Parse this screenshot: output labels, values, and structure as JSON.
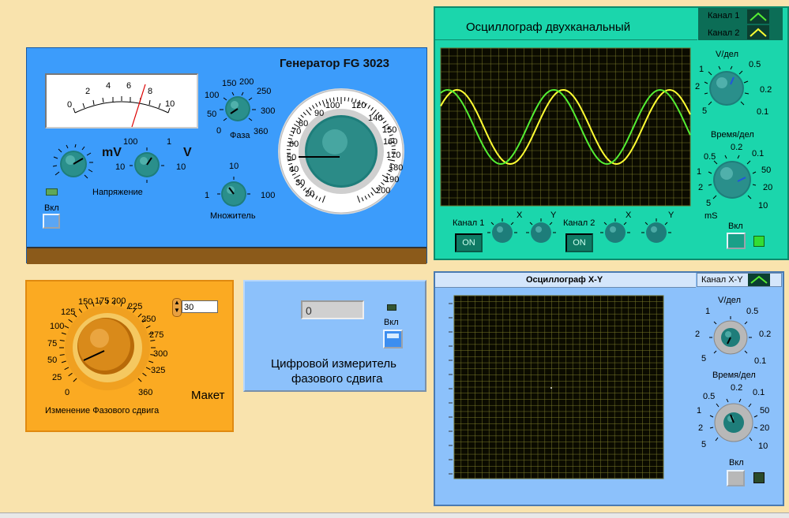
{
  "generator": {
    "title": "Генератор FG 3023",
    "meter_ticks": [
      "0",
      "2",
      "4",
      "6",
      "8",
      "10"
    ],
    "mv_label": "mV",
    "v_label": "V",
    "range_ticks": {
      "top": "100",
      "right": "1",
      "left": "10",
      "bottom": "10"
    },
    "voltage_label": "Напряжение",
    "on_label": "Вкл",
    "phase": {
      "label": "Фаза",
      "ticks": [
        "150",
        "200",
        "250",
        "100",
        "300",
        "50",
        "0",
        "360"
      ]
    },
    "multiplier": {
      "label": "Множитель",
      "ticks": [
        "10",
        "1",
        "100"
      ]
    },
    "freq_ticks": [
      "100",
      "120",
      "140",
      "150",
      "160",
      "170",
      "180",
      "190",
      "200",
      "90",
      "80",
      "70",
      "60",
      "50",
      "40",
      "30",
      "20"
    ]
  },
  "phase_panel": {
    "input_value": "30",
    "label": "Изменение Фазового сдвига",
    "model_label": "Макет",
    "ticks": [
      "0",
      "25",
      "50",
      "75",
      "100",
      "125",
      "150",
      "175",
      "200",
      "225",
      "250",
      "275",
      "300",
      "325",
      "360"
    ]
  },
  "phase_meter": {
    "value": "0",
    "on_label": "Вкл",
    "title_line1": "Цифровой измеритель",
    "title_line2": "фазового сдвига"
  },
  "osc2": {
    "title": "Осциллограф двухканальный",
    "ch1_label": "Канал 1",
    "ch2_label": "Канал 2",
    "ch1_color": "#ffff33",
    "ch2_color": "#55ee33",
    "vdiv_label": "V/дел",
    "vdiv_ticks": [
      "0.5",
      "1",
      "2",
      "0.2",
      "5",
      "0.1"
    ],
    "tdiv_label": "Время/дел",
    "tdiv_ticks": [
      "0.2",
      "0.5",
      "0.1",
      "1",
      "50",
      "2",
      "20",
      "5",
      "10"
    ],
    "units": "mS",
    "on_label": "Вкл",
    "bottom": {
      "ch1": "Канал 1",
      "ch2": "Канал 2",
      "on": "ON",
      "x": "X",
      "y": "Y"
    }
  },
  "oscxy": {
    "title": "Осциллограф X-Y",
    "channel_label": "Канал X-Y",
    "vdiv_label": "V/дел",
    "vdiv_ticks": [
      "1",
      "0.5",
      "2",
      "0.2",
      "5",
      "0.1"
    ],
    "tdiv_label": "Время/дел",
    "tdiv_ticks": [
      "0.2",
      "0.5",
      "0.1",
      "1",
      "50",
      "2",
      "20",
      "5",
      "10"
    ],
    "on_label": "Вкл"
  },
  "colors": {
    "background": "#f9e3ad",
    "generator_panel": "#3c9cfb",
    "phase_panel": "#fbaa22",
    "meter_panel": "#8cc1fb",
    "osc_panel": "#1bd6ac",
    "xy_panel": "#8cc1fb",
    "screen": "#0b0b00",
    "grid": "#7a7a2a"
  }
}
